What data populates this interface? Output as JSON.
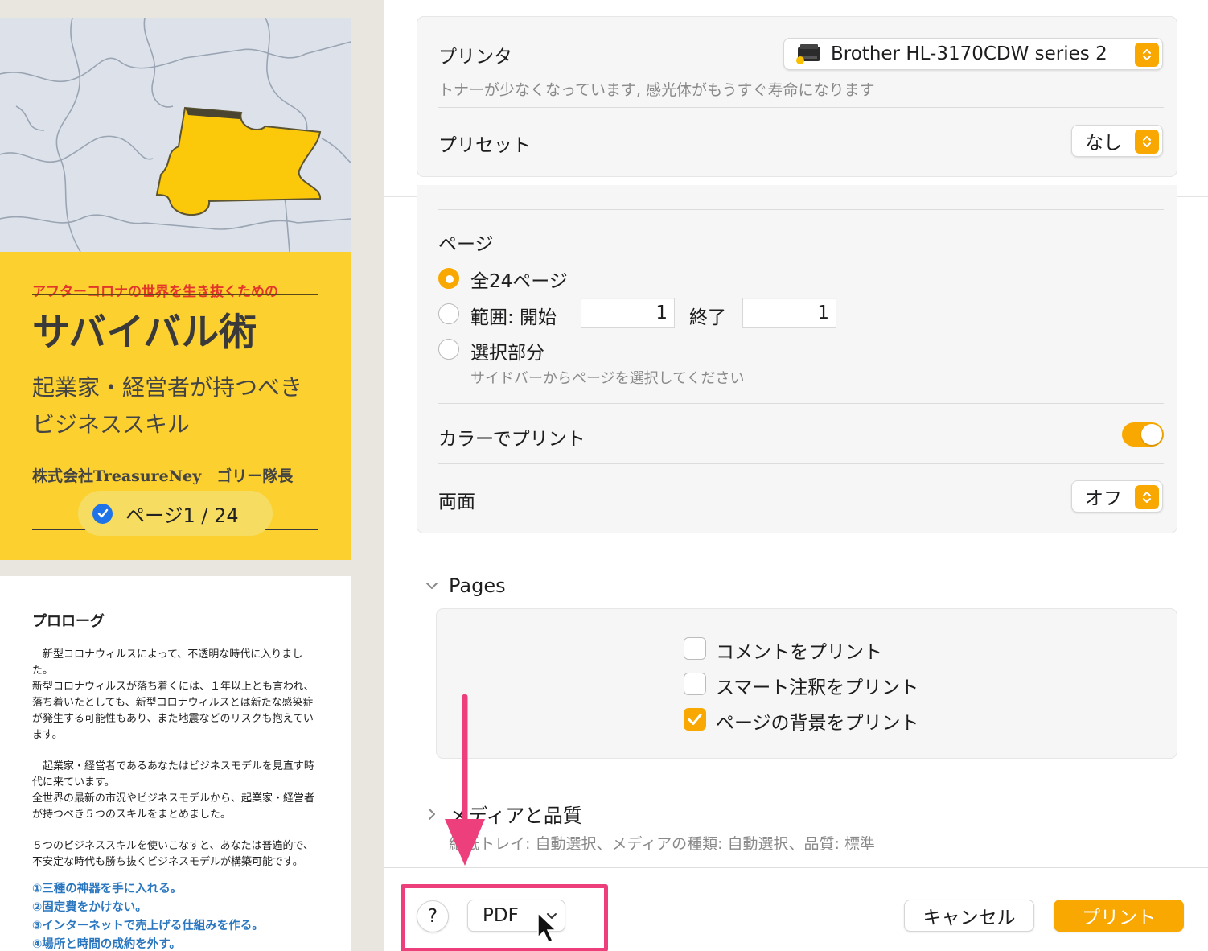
{
  "sidebar": {
    "cover": {
      "subtitle": "アフターコロナの世界を生き抜くための",
      "title": "サバイバル術",
      "line1": "起業家・経営者が持つべき",
      "line2": "ビジネススキル",
      "author": "株式会社TreasureNey　ゴリー隊長",
      "page_badge": "ページ1 / 24",
      "colors": {
        "background": "#fcd12f",
        "subtitle": "#e2362a"
      }
    },
    "page2": {
      "title": "プロローグ",
      "paragraphs": [
        "　新型コロナウィルスによって、不透明な時代に入りました。\n新型コロナウィルスが落ち着くには、１年以上とも言われ、落ち着いたとしても、新型コロナウィルスとは新たな感染症が発生する可能性もあり、また地震などのリスクも抱えています。",
        "　起業家・経営者であるあなたはビジネスモデルを見直す時代に来ています。\n全世界の最新の市況やビジネスモデルから、起業家・経営者が持つべき５つのスキルをまとめました。",
        "５つのビジネススキルを使いこなすと、あなたは普遍的で、不安定な時代も勝ち抜くビジネスモデルが構築可能です。"
      ],
      "links": [
        "①三種の神器を手に入れる。",
        "②固定費をかけない。",
        "③インターネットで売上げる仕組みを作る。",
        "④場所と時間の成約を外す。"
      ]
    }
  },
  "printer": {
    "label": "プリンタ",
    "value": "Brother HL-3170CDW series 2",
    "warning": "トナーが少なくなっています, 感光体がもうすぐ寿命になります",
    "icon": "printer-icon"
  },
  "preset": {
    "label": "プリセット",
    "value": "なし"
  },
  "pages": {
    "label": "ページ",
    "all_option": "全24ページ",
    "range_option": "範囲: 開始",
    "range_start": "1",
    "range_end_label": "終了",
    "range_end": "1",
    "selection_option": "選択部分",
    "selection_hint": "サイドバーからページを選択してください",
    "selected": "all"
  },
  "color_print": {
    "label": "カラーでプリント",
    "on": true
  },
  "duplex": {
    "label": "両面",
    "value": "オフ"
  },
  "pages_section": {
    "title": "Pages",
    "expanded": true,
    "options": [
      {
        "label": "コメントをプリント",
        "checked": false
      },
      {
        "label": "スマート注釈をプリント",
        "checked": false
      },
      {
        "label": "ページの背景をプリント",
        "checked": true
      }
    ]
  },
  "media_section": {
    "title": "メディアと品質",
    "expanded": false,
    "summary": "給紙トレイ: 自動選択、メディアの種類: 自動選択、品質: 標準"
  },
  "footer": {
    "help": "?",
    "pdf": "PDF",
    "cancel": "キャンセル",
    "print": "プリント"
  },
  "colors": {
    "accent": "#f8a800",
    "annotation": "#ec3f7c"
  }
}
